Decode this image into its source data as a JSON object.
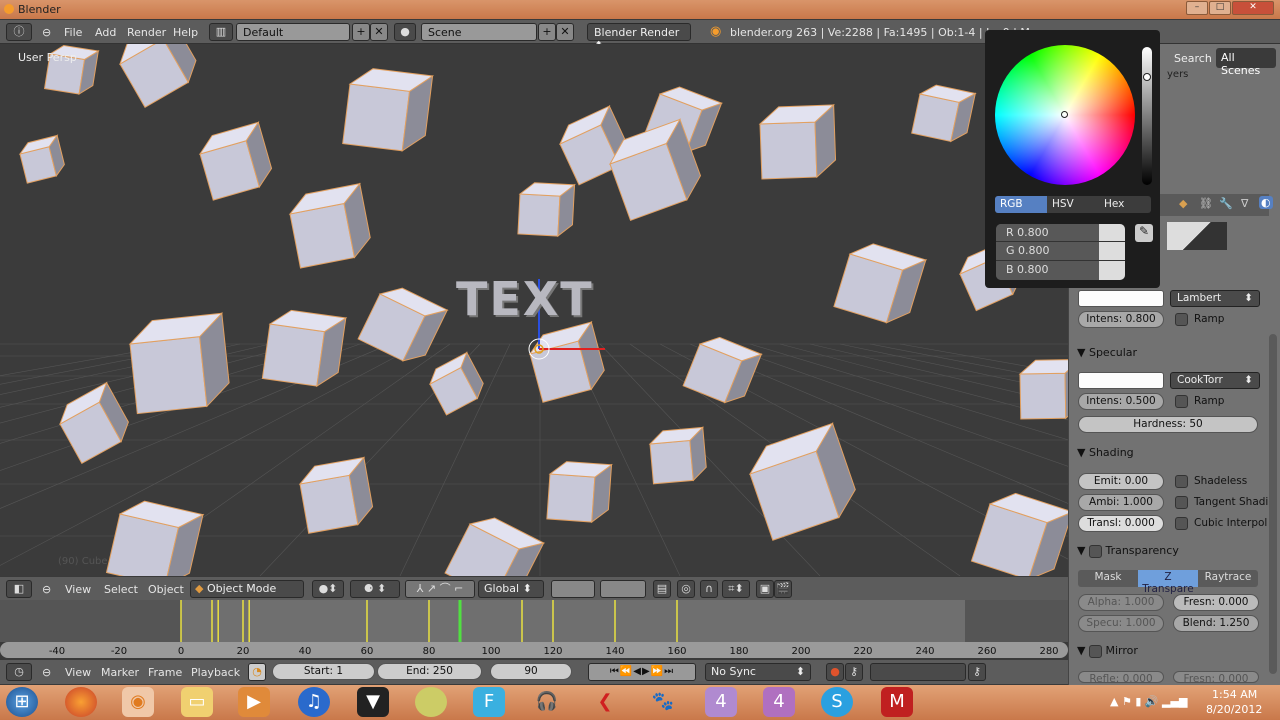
{
  "window": {
    "title": "Blender"
  },
  "top_header": {
    "menus": [
      "File",
      "Add",
      "Render",
      "Help"
    ],
    "screen_layout": "Default",
    "scene": "Scene",
    "render_engine": "Blender Render",
    "stats": "blender.org 263 | Ve:2288 | Fa:1495 | Ob:1-4 | La:0 | M"
  },
  "viewport": {
    "view_label": "User Persp",
    "object_label": "(90) Cube",
    "text_object": "TEXT"
  },
  "outliner": {
    "search_label": "Search",
    "filter": "All Scenes",
    "layers_label": "yers"
  },
  "color_picker": {
    "tabs": [
      "RGB",
      "HSV",
      "Hex"
    ],
    "active_tab": "RGB",
    "r": "R 0.800",
    "g": "G 0.800",
    "b": "B 0.800",
    "value_fraction": 0.8,
    "color": "#cccccc"
  },
  "properties": {
    "diffuse": {
      "shader": "Lambert",
      "intensity": "Intens: 0.800",
      "ramp": "Ramp"
    },
    "specular": {
      "title": "Specular",
      "shader": "CookTorr",
      "intensity": "Intens: 0.500",
      "ramp": "Ramp",
      "hardness": "Hardness: 50"
    },
    "shading": {
      "title": "Shading",
      "emit": "Emit: 0.00",
      "ambi": "Ambi: 1.000",
      "transl": "Transl: 0.000",
      "shadeless": "Shadeless",
      "tangent": "Tangent Shadi",
      "cubic": "Cubic Interpol"
    },
    "transparency": {
      "title": "Transparency",
      "modes": [
        "Mask",
        "Z Transpare",
        "Raytrace"
      ],
      "active_mode": "Z Transpare",
      "alpha": "Alpha: 1.000",
      "fresnel": "Fresn: 0.000",
      "specular": "Specu: 1.000",
      "blend": "Blend: 1.250"
    },
    "mirror": {
      "title": "Mirror",
      "reflect": "Refle: 0.000",
      "fresnel": "Fresn: 0.000"
    }
  },
  "view3d_header": {
    "menus": [
      "View",
      "Select",
      "Object"
    ],
    "mode": "Object Mode",
    "orientation": "Global"
  },
  "timeline": {
    "ruler_ticks": [
      -40,
      -20,
      0,
      20,
      40,
      60,
      80,
      100,
      120,
      140,
      160,
      180,
      200,
      220,
      240,
      260,
      280
    ],
    "keyframes": [
      0,
      10,
      12,
      20,
      22,
      60,
      80,
      110,
      120,
      140,
      160
    ],
    "current_frame_marker": 90,
    "menus": [
      "View",
      "Marker",
      "Frame",
      "Playback"
    ],
    "start": "Start: 1",
    "end": "End: 250",
    "current": "90",
    "sync": "No Sync"
  },
  "taskbar": {
    "time": "1:54 AM",
    "date": "8/20/2012"
  }
}
